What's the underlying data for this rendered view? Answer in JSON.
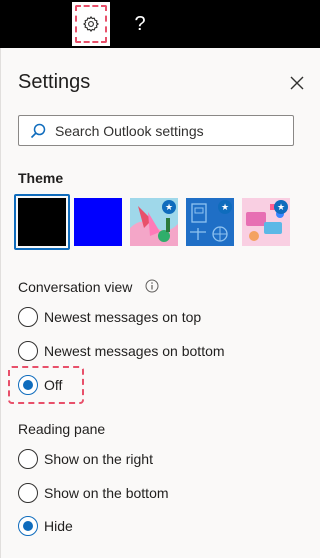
{
  "topbar": {
    "settings_icon": "gear-icon",
    "help_label": "?"
  },
  "panel": {
    "title": "Settings",
    "close_icon": "close-icon",
    "search_placeholder": "Search Outlook settings"
  },
  "theme": {
    "label": "Theme",
    "swatches": [
      {
        "name": "Black",
        "color": "#000000",
        "selected": true
      },
      {
        "name": "Blue",
        "color": "#0000ff",
        "selected": false
      },
      {
        "name": "Illustrated theme 1",
        "featured": true
      },
      {
        "name": "Illustrated theme 2",
        "featured": true
      },
      {
        "name": "Illustrated theme 3",
        "featured": true
      }
    ]
  },
  "conversation_view": {
    "label": "Conversation view",
    "options": [
      {
        "label": "Newest messages on top",
        "checked": false
      },
      {
        "label": "Newest messages on bottom",
        "checked": false
      },
      {
        "label": "Off",
        "checked": true
      }
    ]
  },
  "reading_pane": {
    "label": "Reading pane",
    "options": [
      {
        "label": "Show on the right",
        "checked": false
      },
      {
        "label": "Show on the bottom",
        "checked": false
      },
      {
        "label": "Hide",
        "checked": true
      }
    ]
  },
  "colors": {
    "accent": "#0f6cbd",
    "highlight": "#e8506a"
  }
}
